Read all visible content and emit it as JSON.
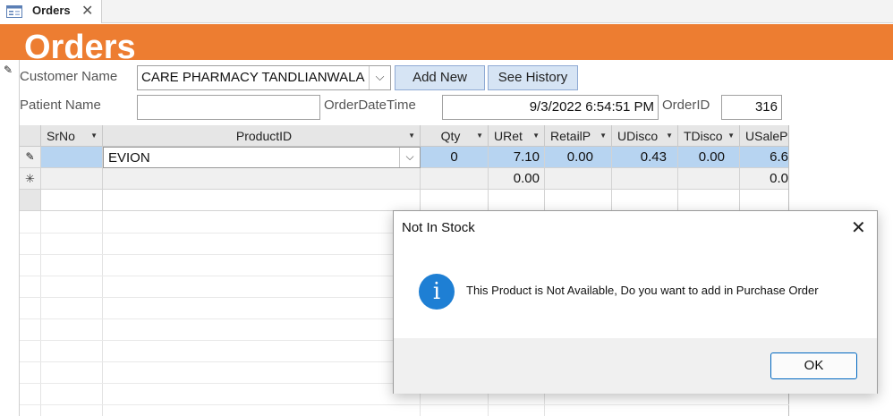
{
  "tab": {
    "label": "Orders",
    "close_glyph": "✕",
    "icon": "form-icon"
  },
  "header": {
    "title": "Orders",
    "accent_color": "#ed7d31"
  },
  "form": {
    "customer_label": "Customer Name",
    "customer_value": "CARE PHARMACY TANDLIANWALA",
    "dropdown_glyph": "⌵",
    "add_new_label": "Add New",
    "see_history_label": "See History",
    "patient_label": "Patient Name",
    "patient_value": "",
    "orderdate_label": "OrderDateTime",
    "orderdate_value": "9/3/2022 6:54:51 PM",
    "orderid_label": "OrderID",
    "orderid_value": "316"
  },
  "grid": {
    "columns": [
      "SrNo",
      "ProductID",
      "Qty",
      "URet",
      "RetailP",
      "UDisco",
      "TDisco",
      "USaleP"
    ],
    "row1": {
      "srno": "",
      "product": "EVION",
      "qty": "0",
      "uret": "7.10",
      "retailp": "0.00",
      "udisco": "0.43",
      "tdisco": "0.00",
      "usalep": "6.6"
    },
    "new_row": {
      "selector": "✳",
      "uret": "0.00",
      "usalep": "0.0"
    },
    "edit_glyph": "✎"
  },
  "dialog": {
    "title": "Not In Stock",
    "close_glyph": "✕",
    "icon_glyph": "i",
    "message": "This Product is Not Available, Do you want to add in Purchase Order",
    "ok_label": "OK",
    "icon_color": "#1e7fd4"
  }
}
